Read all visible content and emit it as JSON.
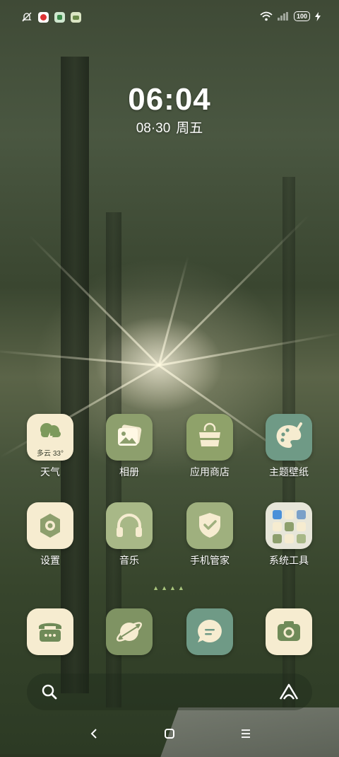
{
  "clock": {
    "time": "06:04",
    "date": "08·30",
    "weekday": "周五"
  },
  "status_bar": {
    "left_icons": [
      "mute-bell-icon",
      "app-notification-icon",
      "app-notification-icon",
      "app-notification-icon"
    ],
    "battery": "100",
    "right_icons": [
      "wifi-icon",
      "signal-icon",
      "battery-icon",
      "charging-icon"
    ]
  },
  "apps": {
    "weather": {
      "label": "天气",
      "widget_text": "多云 33°"
    },
    "gallery": {
      "label": "相册"
    },
    "app_store": {
      "label": "应用商店"
    },
    "themes": {
      "label": "主题壁纸"
    },
    "settings": {
      "label": "设置"
    },
    "music": {
      "label": "音乐"
    },
    "security": {
      "label": "手机管家"
    },
    "tools": {
      "label": "系统工具"
    }
  },
  "dock": [
    "phone",
    "browser",
    "messages",
    "camera"
  ],
  "page_indicator": "▲▲▲▲",
  "colors": {
    "cream": "#f6ecd0",
    "olive": "#8d9f6d",
    "sage": "#a8b887",
    "teal": "#6f9a86"
  }
}
